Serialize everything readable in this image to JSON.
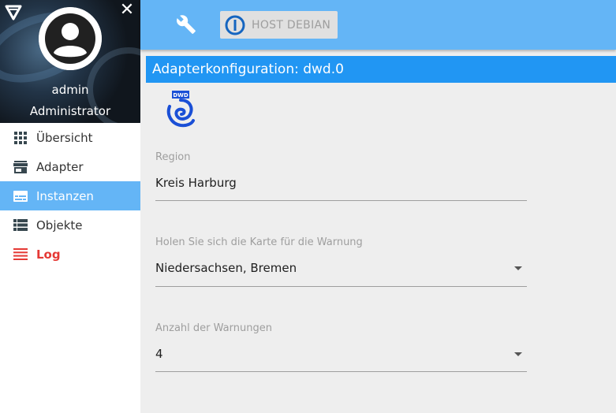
{
  "sidebar": {
    "user_name": "admin",
    "user_role": "Administrator",
    "close_symbol": "✕",
    "items": [
      {
        "label": "Übersicht",
        "icon": "apps-grid-icon"
      },
      {
        "label": "Adapter",
        "icon": "store-icon"
      },
      {
        "label": "Instanzen",
        "icon": "instances-icon",
        "active": true
      },
      {
        "label": "Objekte",
        "icon": "list-icon"
      },
      {
        "label": "Log",
        "icon": "log-lines-icon",
        "color": "#e53935"
      }
    ]
  },
  "topbar": {
    "host_button_label": "HOST DEBIAN"
  },
  "main": {
    "title": "Adapterkonfiguration: dwd.0",
    "logo_text": "DWD",
    "fields": [
      {
        "label": "Region",
        "value": "Kreis Harburg"
      },
      {
        "label": "Holen Sie sich die Karte für die Warnung",
        "value": "Niedersachsen, Bremen"
      },
      {
        "label": "Anzahl der Warnungen",
        "value": "4"
      }
    ]
  },
  "colors": {
    "accent": "#64b5f6",
    "title_bar": "#2196f3",
    "log": "#e53935"
  }
}
